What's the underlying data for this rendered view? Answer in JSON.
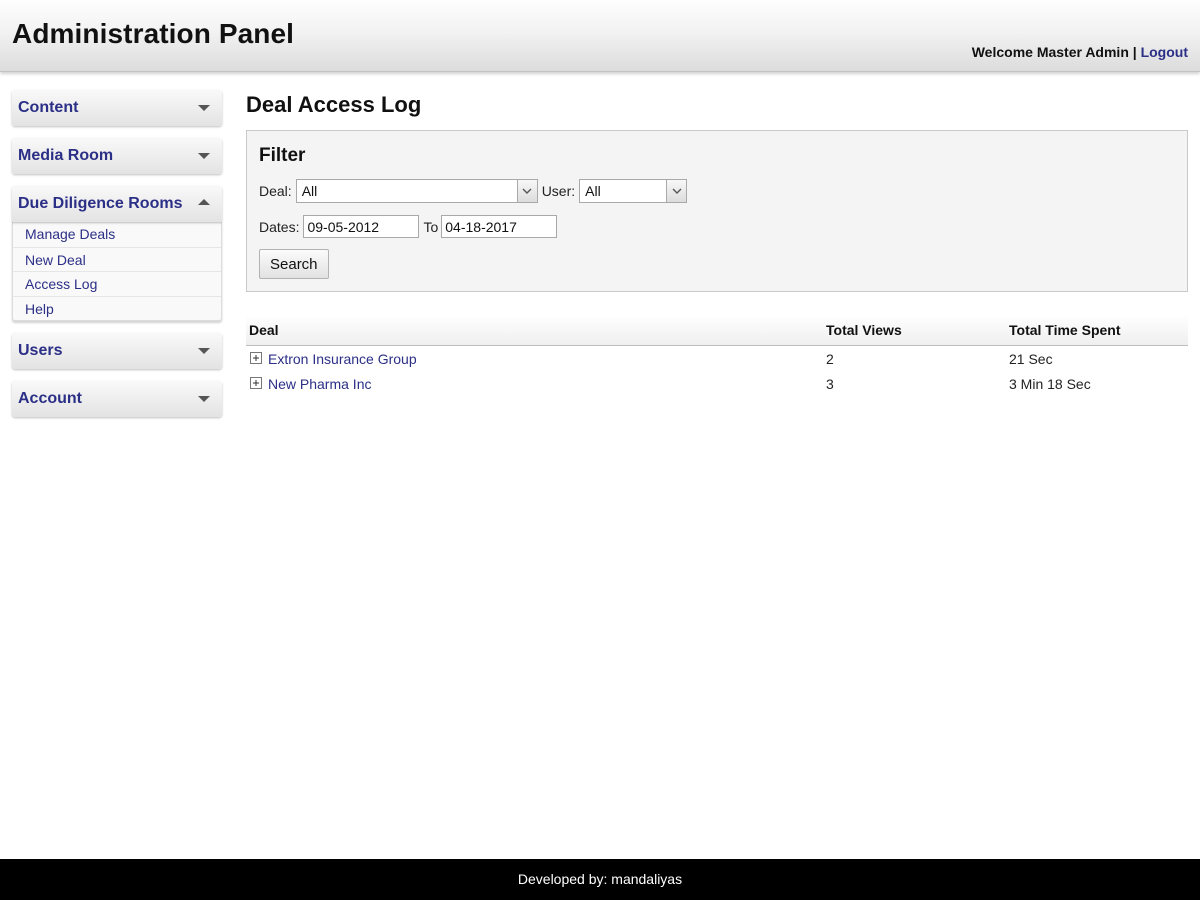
{
  "header": {
    "title": "Administration Panel",
    "welcome_text": "Welcome Master Admin",
    "separator": "|",
    "logout_label": "Logout"
  },
  "sidebar": {
    "menus": [
      {
        "label": "Content",
        "state": "collapsed"
      },
      {
        "label": "Media Room",
        "state": "collapsed"
      },
      {
        "label": "Due Diligence Rooms",
        "state": "expanded",
        "items": [
          "Manage Deals",
          "New Deal",
          "Access Log",
          "Help"
        ]
      },
      {
        "label": "Users",
        "state": "collapsed"
      },
      {
        "label": "Account",
        "state": "collapsed"
      }
    ]
  },
  "main": {
    "page_title": "Deal Access Log",
    "filter": {
      "title": "Filter",
      "deal_label": "Deal:",
      "deal_value": "All",
      "user_label": "User:",
      "user_value": "All",
      "dates_label": "Dates:",
      "date_from": "09-05-2012",
      "to_label": "To",
      "date_to": "04-18-2017",
      "search_label": "Search"
    },
    "table": {
      "columns": [
        "Deal",
        "Total Views",
        "Total Time Spent"
      ],
      "rows": [
        {
          "deal": "Extron Insurance Group",
          "views": "2",
          "time": "21 Sec"
        },
        {
          "deal": "New Pharma Inc",
          "views": "3",
          "time": "3 Min 18 Sec"
        }
      ]
    }
  },
  "footer": {
    "text": "Developed by: mandaliyas"
  },
  "colors": {
    "link": "#2b2f86",
    "footer_bg": "#000000",
    "filter_bg": "#f4f4f4"
  }
}
